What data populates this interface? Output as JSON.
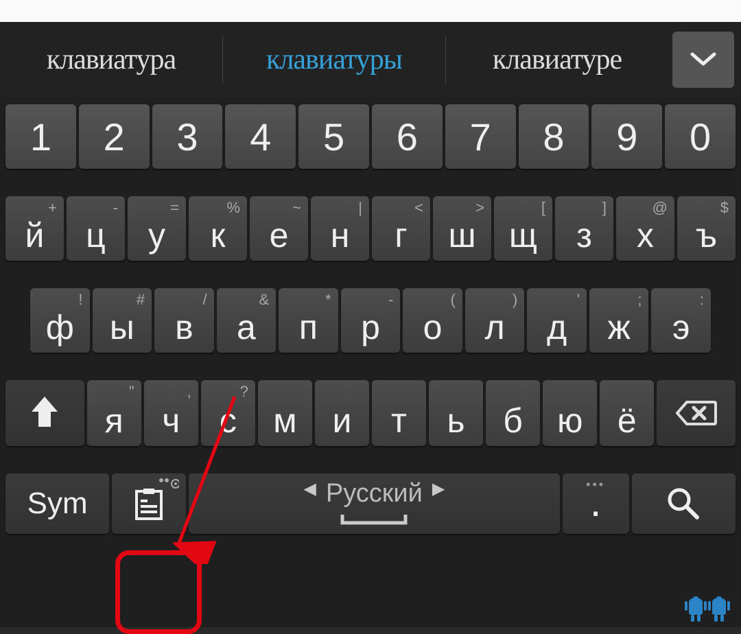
{
  "suggestions": {
    "left": "клавиатура",
    "middle": "клавиатуры",
    "right": "клавиатуре"
  },
  "rows": {
    "numbers": [
      "1",
      "2",
      "3",
      "4",
      "5",
      "6",
      "7",
      "8",
      "9",
      "0"
    ],
    "r1": [
      {
        "m": "й",
        "a": "+"
      },
      {
        "m": "ц",
        "a": "-"
      },
      {
        "m": "у",
        "a": "="
      },
      {
        "m": "к",
        "a": "%"
      },
      {
        "m": "е",
        "a": "~"
      },
      {
        "m": "н",
        "a": "|"
      },
      {
        "m": "г",
        "a": "<"
      },
      {
        "m": "ш",
        "a": ">"
      },
      {
        "m": "щ",
        "a": "["
      },
      {
        "m": "з",
        "a": "]"
      },
      {
        "m": "х",
        "a": "@"
      },
      {
        "m": "ъ",
        "a": "$"
      }
    ],
    "r2": [
      {
        "m": "ф",
        "a": "!"
      },
      {
        "m": "ы",
        "a": "#"
      },
      {
        "m": "в",
        "a": "/"
      },
      {
        "m": "а",
        "a": "&"
      },
      {
        "m": "п",
        "a": "*"
      },
      {
        "m": "р",
        "a": "-"
      },
      {
        "m": "о",
        "a": "("
      },
      {
        "m": "л",
        "a": ")"
      },
      {
        "m": "д",
        "a": "'"
      },
      {
        "m": "ж",
        "a": ";"
      },
      {
        "m": "э",
        "a": ":"
      }
    ],
    "r3": [
      {
        "m": "я",
        "a": "\""
      },
      {
        "m": "ч",
        "a": ","
      },
      {
        "m": "с",
        "a": "?"
      },
      {
        "m": "м",
        "a": ""
      },
      {
        "m": "и",
        "a": ""
      },
      {
        "m": "т",
        "a": ""
      },
      {
        "m": "ь",
        "a": ""
      },
      {
        "m": "б",
        "a": ""
      },
      {
        "m": "ю",
        "a": ""
      },
      {
        "m": "ё",
        "a": ""
      }
    ]
  },
  "bottom": {
    "sym": "Sym",
    "space_lang": "Русский",
    "dot": "."
  }
}
